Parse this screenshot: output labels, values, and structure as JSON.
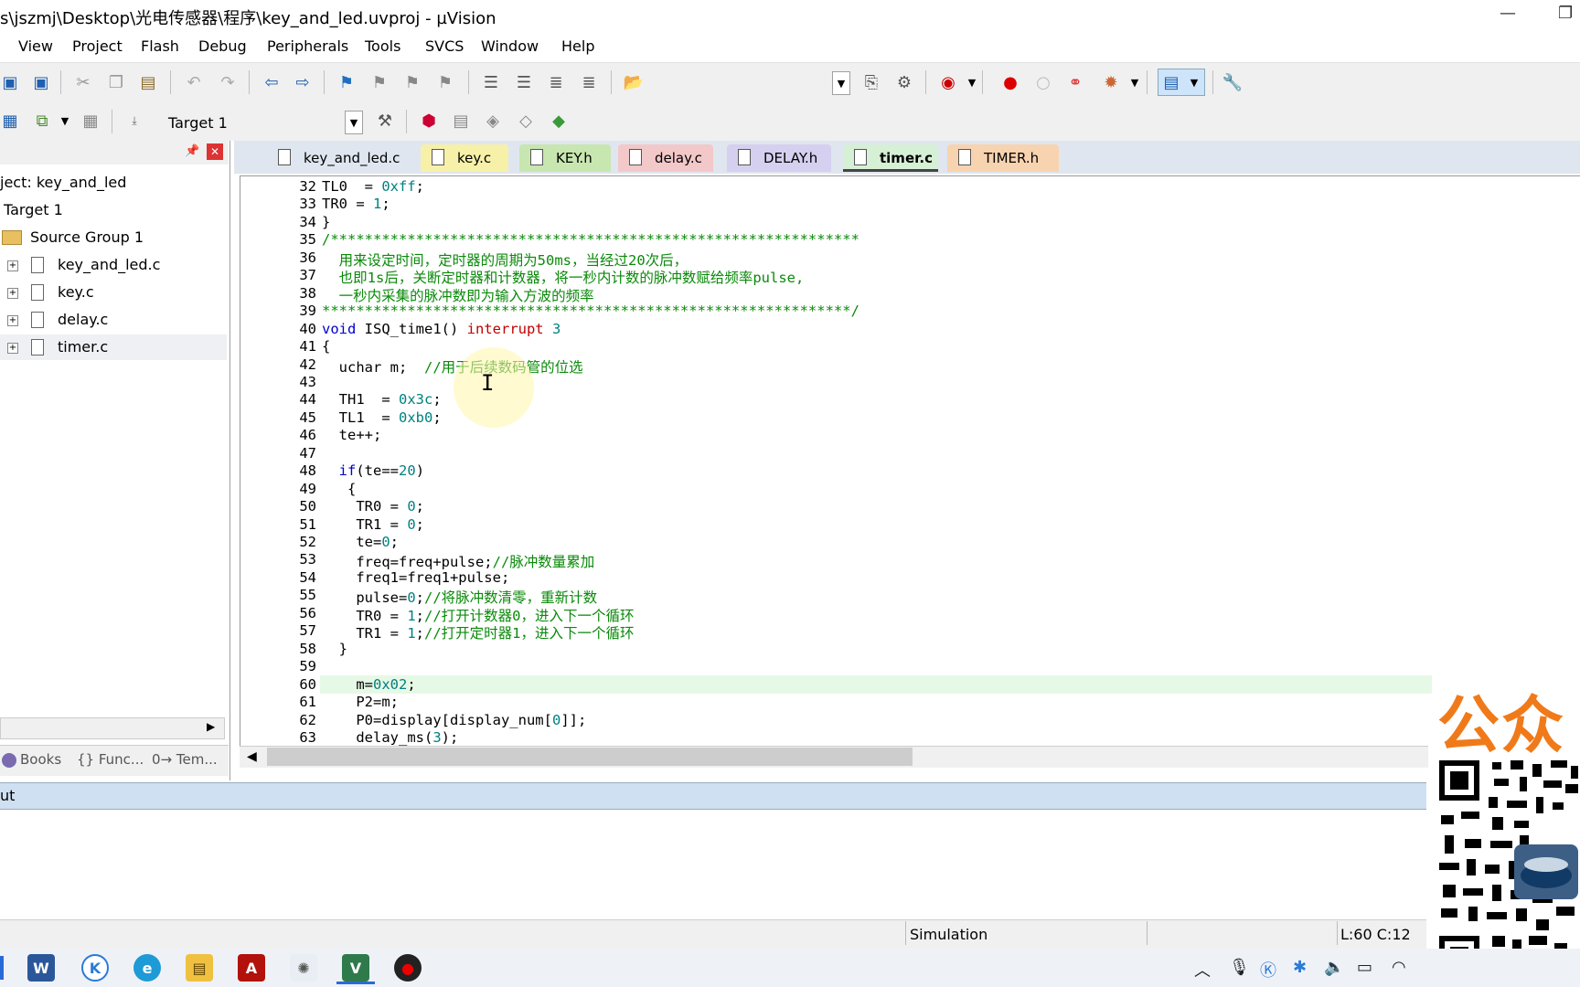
{
  "window": {
    "title": "s\\jszmj\\Desktop\\光电传感器\\程序\\key_and_led.uvproj - µVision"
  },
  "menu": [
    "View",
    "Project",
    "Flash",
    "Debug",
    "Peripherals",
    "Tools",
    "SVCS",
    "Window",
    "Help"
  ],
  "toolbar2": {
    "target": "Target 1"
  },
  "project": {
    "root": "ject: key_and_led",
    "target": "Target 1",
    "group": "Source Group 1",
    "files": [
      "key_and_led.c",
      "key.c",
      "delay.c",
      "timer.c"
    ]
  },
  "panel_tabs": [
    "Books",
    "{} Func...",
    "0→ Tem..."
  ],
  "tabs": [
    {
      "label": "key_and_led.c",
      "color": "#dfe6ef"
    },
    {
      "label": "key.c",
      "color": "#f7f0a8"
    },
    {
      "label": "KEY.h",
      "color": "#c8e6b0"
    },
    {
      "label": "delay.c",
      "color": "#f3c8c8"
    },
    {
      "label": "DELAY.h",
      "color": "#d5d0ef"
    },
    {
      "label": "timer.c",
      "color": "#d6f0d6"
    },
    {
      "label": "TIMER.h",
      "color": "#f8d3b0"
    }
  ],
  "code": [
    {
      "n": "32",
      "t": "TL0  = 0xff;"
    },
    {
      "n": "33",
      "t": "TR0 = 1;"
    },
    {
      "n": "34",
      "t": "}"
    },
    {
      "n": "35",
      "t": "/**************************************************************"
    },
    {
      "n": "36",
      "t": "  用来设定时间，定时器的周期为50ms，当经过20次后，"
    },
    {
      "n": "37",
      "t": "  也即1s后，关断定时器和计数器，将一秒内计数的脉冲数赋给频率pulse,"
    },
    {
      "n": "38",
      "t": "  一秒内采集的脉冲数即为输入方波的频率"
    },
    {
      "n": "39",
      "t": "**************************************************************/"
    },
    {
      "n": "40",
      "t": "void ISQ_time1() interrupt 3"
    },
    {
      "n": "41",
      "t": "{"
    },
    {
      "n": "42",
      "t": "  uchar m;  //用于后续数码管的位选"
    },
    {
      "n": "43",
      "t": ""
    },
    {
      "n": "44",
      "t": "  TH1  = 0x3c;"
    },
    {
      "n": "45",
      "t": "  TL1  = 0xb0;"
    },
    {
      "n": "46",
      "t": "  te++;"
    },
    {
      "n": "47",
      "t": ""
    },
    {
      "n": "48",
      "t": "  if(te==20)"
    },
    {
      "n": "49",
      "t": "   {"
    },
    {
      "n": "50",
      "t": "    TR0 = 0;"
    },
    {
      "n": "51",
      "t": "    TR1 = 0;"
    },
    {
      "n": "52",
      "t": "    te=0;"
    },
    {
      "n": "53",
      "t": "    freq=freq+pulse;//脉冲数量累加"
    },
    {
      "n": "54",
      "t": "    freq1=freq1+pulse;"
    },
    {
      "n": "55",
      "t": "    pulse=0;//将脉冲数清零，重新计数"
    },
    {
      "n": "56",
      "t": "    TR0 = 1;//打开计数器0，进入下一个循环"
    },
    {
      "n": "57",
      "t": "    TR1 = 1;//打开定时器1，进入下一个循环"
    },
    {
      "n": "58",
      "t": "  }"
    },
    {
      "n": "59",
      "t": ""
    },
    {
      "n": "60",
      "t": "    m=0x02;"
    },
    {
      "n": "61",
      "t": "    P2=m;"
    },
    {
      "n": "62",
      "t": "    P0=display[display_num[0]];"
    },
    {
      "n": "63",
      "t": "    delay_ms(3);"
    }
  ],
  "output": {
    "title": "ut"
  },
  "status": {
    "mode": "Simulation",
    "position": "L:60 C:12"
  },
  "overlay": {
    "text": "公众"
  }
}
